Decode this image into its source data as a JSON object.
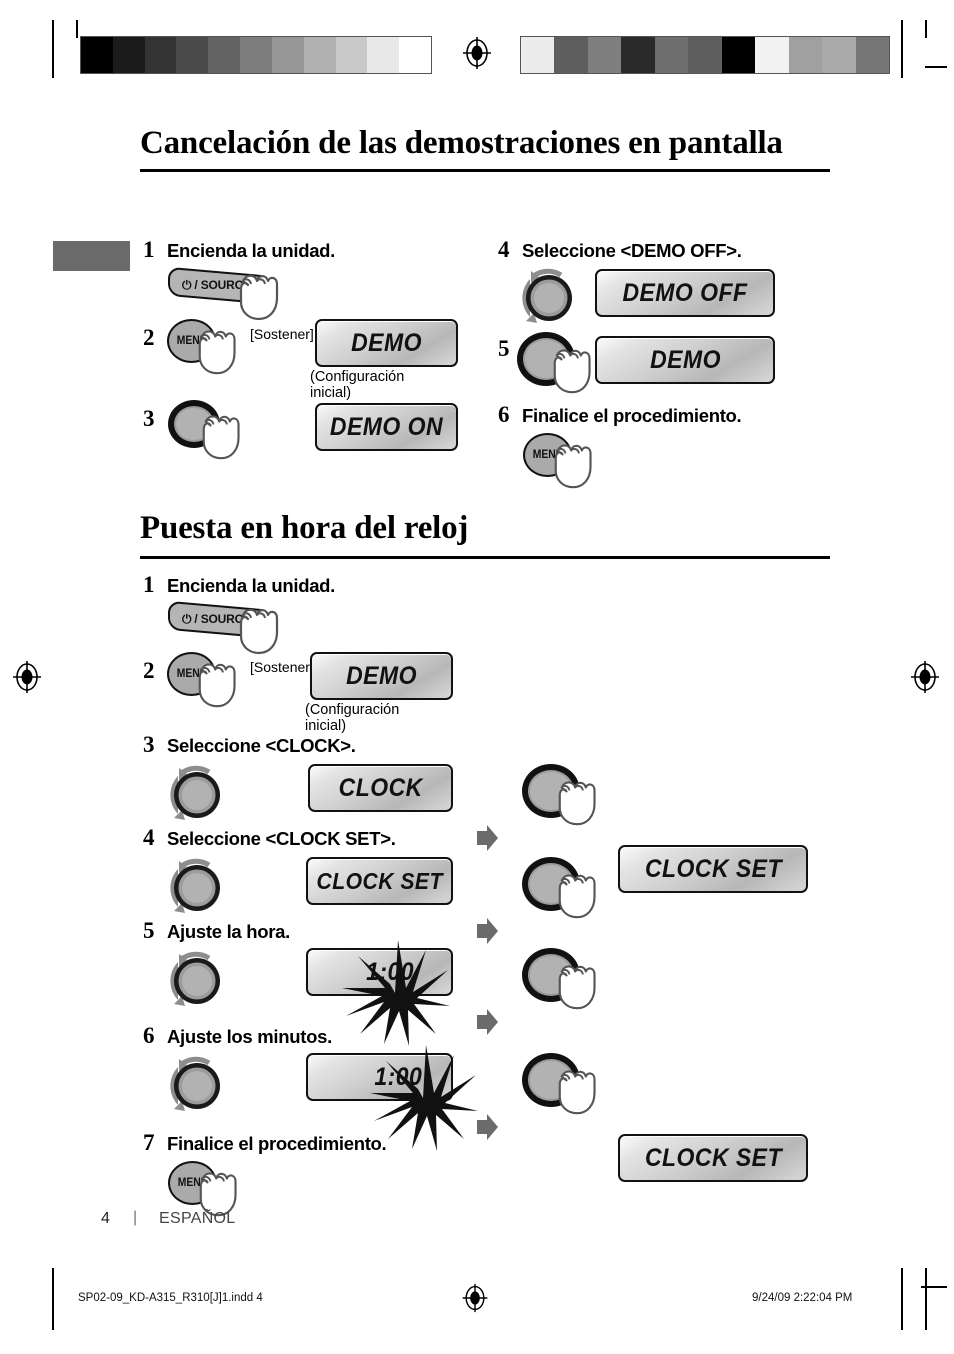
{
  "page": {
    "page_number": "4",
    "separator": "|",
    "language": "ESPAÑOL",
    "imprint_left": "SP02-09_KD-A315_R310[J]1.indd   4",
    "imprint_right": "9/24/09   2:22:04 PM"
  },
  "colors": {
    "ink": "#000000",
    "panel_border": "#111111",
    "button_fill": "#b5b5b5",
    "knob_fill": "#9c9c9c",
    "arrow_gray": "#6b6b6b",
    "tab_gray": "#6b6b6b"
  },
  "calibration": {
    "left_bar": [
      "#000000",
      "#1b1b1b",
      "#333333",
      "#4b4b4b",
      "#636363",
      "#7d7d7d",
      "#969696",
      "#b0b0b0",
      "#c9c9c9",
      "#e8e8e8",
      "#ffffff"
    ],
    "right_bar": [
      "#ececec",
      "#5e5e5e",
      "#7f7f7f",
      "#2a2a2a",
      "#6e6e6e",
      "#5e5e5e",
      "#000000",
      "#f2f2f2",
      "#a0a0a0",
      "#aaaaaa",
      "#767676"
    ]
  },
  "icons": {
    "source_button_label": "⏻ / SOURCE",
    "menu_button_label": "MENU",
    "power_glyph": "⏻"
  },
  "sections": [
    {
      "id": "demo-cancel",
      "title": "Cancelación de las demostraciones en pantalla",
      "left_steps": [
        {
          "num": "1",
          "text": "Encienda la unidad.",
          "control": "source-button",
          "display": null,
          "note": null,
          "hint": null
        },
        {
          "num": "2",
          "text": "",
          "control": "menu-button",
          "display": "DEMO",
          "note": "(Configuración inicial)",
          "hint": "[Sostener]"
        },
        {
          "num": "3",
          "text": "",
          "control": "knob-press",
          "display": "DEMO ON",
          "note": null,
          "hint": null
        }
      ],
      "right_steps": [
        {
          "num": "4",
          "text": "Seleccione <DEMO OFF>.",
          "control": "knob-rotate",
          "display": "DEMO OFF",
          "note": null,
          "hint": null
        },
        {
          "num": "5",
          "text": "",
          "control": "knob-press",
          "display": "DEMO",
          "note": null,
          "hint": null
        },
        {
          "num": "6",
          "text": "Finalice el procedimiento.",
          "control": "menu-button",
          "display": null,
          "note": null,
          "hint": null
        }
      ]
    },
    {
      "id": "clock-set",
      "title": "Puesta en hora del reloj",
      "steps": [
        {
          "num": "1",
          "text": "Encienda la unidad.",
          "control": "source-button",
          "display": null,
          "note": null,
          "hint": null,
          "second_control": null,
          "second_display": null
        },
        {
          "num": "2",
          "text": "",
          "control": "menu-button",
          "display": "DEMO",
          "note": "(Configuración inicial)",
          "hint": "[Sostener]",
          "second_control": null,
          "second_display": null
        },
        {
          "num": "3",
          "text": "Seleccione <CLOCK>.",
          "control": "knob-rotate",
          "display": "CLOCK",
          "note": null,
          "hint": null,
          "second_control": "knob-press",
          "second_display": "CLOCK SET"
        },
        {
          "num": "4",
          "text": "Seleccione <CLOCK SET>.",
          "control": "knob-rotate",
          "display": "CLOCK SET",
          "note": null,
          "hint": null,
          "second_control": "knob-press",
          "second_display": null
        },
        {
          "num": "5",
          "text": "Ajuste la hora.",
          "control": "knob-rotate",
          "display": "1:00",
          "display_blink": "hour",
          "note": null,
          "hint": null,
          "second_control": "knob-press",
          "second_display": null
        },
        {
          "num": "6",
          "text": "Ajuste los minutos.",
          "control": "knob-rotate",
          "display": "1:00",
          "display_blink": "minute",
          "note": null,
          "hint": null,
          "second_control": "knob-press",
          "second_display": "CLOCK SET"
        },
        {
          "num": "7",
          "text": "Finalice el procedimiento.",
          "control": "menu-button",
          "display": null,
          "note": null,
          "hint": null,
          "second_control": null,
          "second_display": null
        }
      ]
    }
  ]
}
